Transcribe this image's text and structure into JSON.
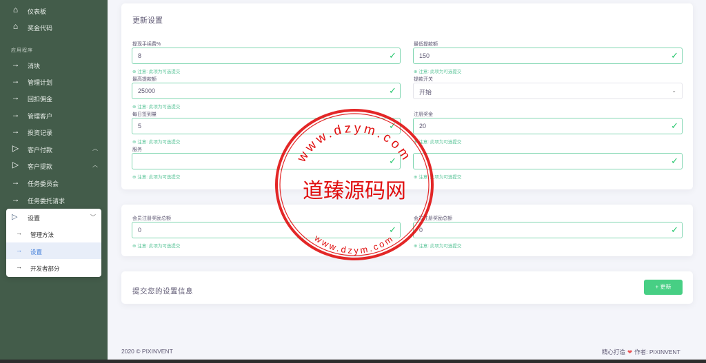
{
  "sidebar": {
    "top_items": [
      {
        "label": "仪表板",
        "icon": "home-icon"
      },
      {
        "label": "奖金代码",
        "icon": "home-icon"
      }
    ],
    "section_label": "应用程序",
    "items": [
      {
        "label": "消块",
        "icon": "arrow-right-icon"
      },
      {
        "label": "管理计划",
        "icon": "arrow-right-icon"
      },
      {
        "label": "回扣佣金",
        "icon": "arrow-right-icon"
      },
      {
        "label": "管理客户",
        "icon": "arrow-right-icon"
      },
      {
        "label": "投资记录",
        "icon": "arrow-right-icon"
      },
      {
        "label": "客户付款",
        "icon": "play-icon"
      },
      {
        "label": "客户提款",
        "icon": "play-icon"
      },
      {
        "label": "任务委员会",
        "icon": "arrow-right-icon"
      },
      {
        "label": "任务委托请求",
        "icon": "arrow-right-icon"
      }
    ],
    "submenu": {
      "label": "设置",
      "items": [
        {
          "label": "管理方法"
        },
        {
          "label": "设置"
        },
        {
          "label": "开发者部分"
        }
      ]
    }
  },
  "settings": {
    "title": "更新设置",
    "fields": {
      "fee": {
        "label": "提现手续费%",
        "value": "8",
        "help": "⊕ 注意: 此项为可选提交"
      },
      "min_withdraw": {
        "label": "最低提款额",
        "value": "150",
        "help": "⊕ 注意: 此项为可选提交"
      },
      "max_withdraw": {
        "label": "最高提款额",
        "value": "25000",
        "help": "⊕ 注意: 此项为可选提交"
      },
      "withdraw_switch": {
        "label": "提款开关",
        "value": "开始"
      },
      "daily_sign": {
        "label": "每日签到量",
        "value": "5",
        "help": "⊕ 注意: 此项为可选提交"
      },
      "register_bonus": {
        "label": "注册奖金",
        "value": "20",
        "help": "⊕ 注意: 此项为可选提交"
      },
      "service": {
        "label": "服务",
        "value": "",
        "help": "⊕ 注意: 此项为可选提交"
      },
      "right_bottom": {
        "label": "",
        "value": "",
        "help": "⊕ 注意: 此项为可选提交"
      }
    }
  },
  "reward": {
    "left": {
      "label": "会员注册奖励总额",
      "value": "0",
      "help": "⊕ 注意: 此项为可选提交"
    },
    "right": {
      "label": "会员注册奖励总额",
      "value": "0",
      "help": "⊕ 注意: 此项为可选提交"
    }
  },
  "submit": {
    "title": "提交您的设置信息",
    "button": "+ 更新"
  },
  "footer": {
    "copyright": "2020 © PIXINVENT",
    "crafted": "精心打造",
    "author_prefix": "作者:",
    "author": "PIXINVENT"
  },
  "watermark": {
    "text": "道臻源码网",
    "url_top": "www.dzym.com",
    "url_bottom": "www.dzym.com"
  },
  "colors": {
    "sidebar": "#435c4a",
    "accent_green": "#28c76f",
    "seal_red": "#e01010"
  }
}
